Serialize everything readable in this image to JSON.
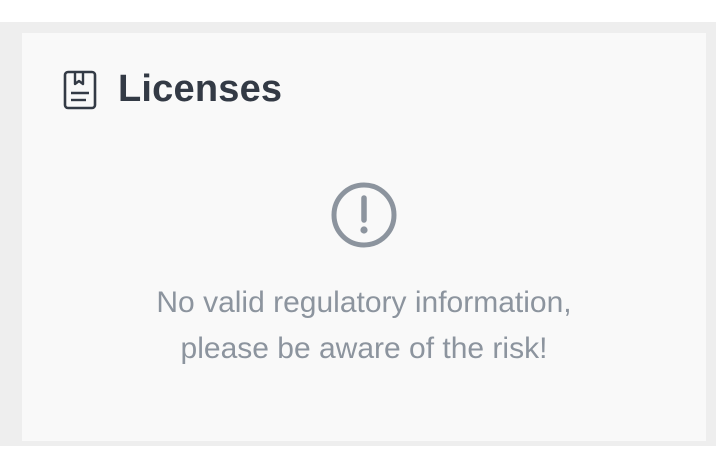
{
  "licenses_card": {
    "title": "Licenses",
    "header_icon": "license-document-icon",
    "empty_state": {
      "icon": "warning-circle-icon",
      "message_line1": "No valid regulatory information,",
      "message_line2": "please be aware of the risk!"
    }
  },
  "colors": {
    "card_background": "#f9f9f9",
    "title_text": "#333a45",
    "icon_gray": "#8c949e",
    "message_text": "#8c949e"
  }
}
